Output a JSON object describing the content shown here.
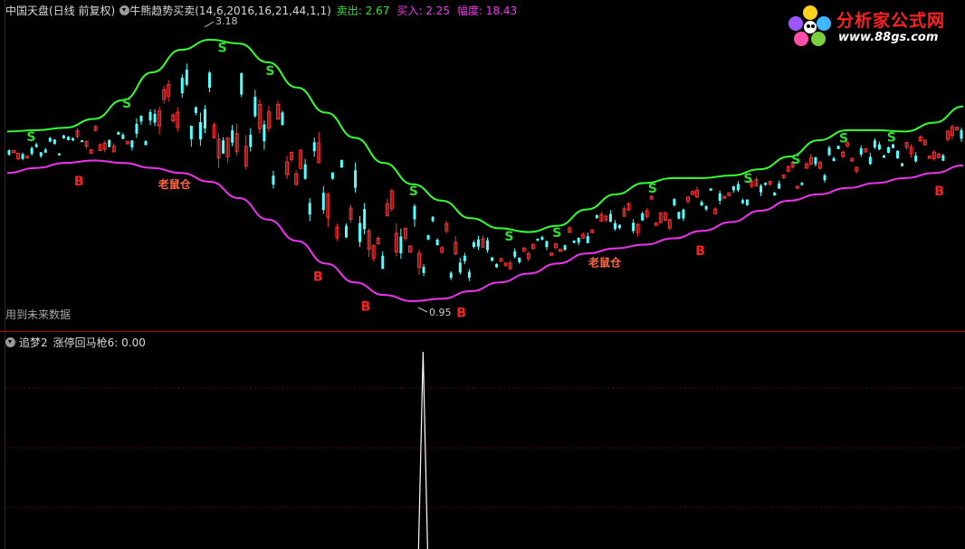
{
  "header": {
    "stock_name": "中国天盘",
    "period": "(日线 前复权)",
    "indicator": "牛熊趋势买卖(14,6,2016,16,21,44,1,1)",
    "sell_label": "卖出: 2.67",
    "buy_label": "买入: 2.25",
    "amplitude_label": "幅度: 18.43"
  },
  "future_note": "用到未来数据",
  "sub_header": {
    "name": "追梦2",
    "value_label": "涨停回马枪6: 0.00"
  },
  "logo": {
    "name": "分析家公式网",
    "url": "www.88gs.com"
  },
  "colors": {
    "up_candle": "#ff3030",
    "down_candle": "#54ffff",
    "upper_band": "#33ff33",
    "lower_band": "#ee33ee",
    "buy_marker": "#ff2020",
    "sell_marker": "#33dd33",
    "annotation": "#ff6644"
  },
  "chart_data": [
    {
      "type": "line",
      "price_range": [
        0.95,
        3.18
      ],
      "max_price_label": "3.18",
      "min_price_label": "0.95",
      "upper_band": [
        2.35,
        2.36,
        2.38,
        2.45,
        2.6,
        2.82,
        3.0,
        3.08,
        3.05,
        2.9,
        2.7,
        2.5,
        2.3,
        2.1,
        1.93,
        1.8,
        1.66,
        1.58,
        1.55,
        1.6,
        1.73,
        1.85,
        1.94,
        1.98,
        1.98,
        2.0,
        2.05,
        2.15,
        2.28,
        2.36,
        2.36,
        2.35,
        2.42,
        2.55
      ],
      "lower_band": [
        2.02,
        2.06,
        2.1,
        2.12,
        2.1,
        2.06,
        2.02,
        1.95,
        1.82,
        1.65,
        1.48,
        1.3,
        1.15,
        1.05,
        1.0,
        1.02,
        1.08,
        1.15,
        1.22,
        1.3,
        1.38,
        1.42,
        1.45,
        1.5,
        1.56,
        1.63,
        1.72,
        1.8,
        1.85,
        1.9,
        1.94,
        1.98,
        2.02,
        2.08
      ],
      "signals": [
        {
          "text": "S"
        },
        {
          "text": "B"
        },
        {
          "text": "S"
        },
        {
          "text": "老鼠仓"
        },
        {
          "text": "S"
        },
        {
          "text": "S"
        },
        {
          "text": "B"
        },
        {
          "text": "B"
        },
        {
          "text": "S"
        },
        {
          "text": "B"
        },
        {
          "text": "S"
        },
        {
          "text": "S"
        },
        {
          "text": "老鼠仓"
        },
        {
          "text": "S"
        },
        {
          "text": "B"
        },
        {
          "text": "S"
        },
        {
          "text": "S"
        },
        {
          "text": "S"
        },
        {
          "text": "S"
        },
        {
          "text": "B"
        }
      ]
    },
    {
      "type": "bar",
      "title": "涨停回马枪6",
      "current_value": 0.0,
      "spike_index_fraction": 0.435,
      "spike_value": 1.0
    }
  ]
}
